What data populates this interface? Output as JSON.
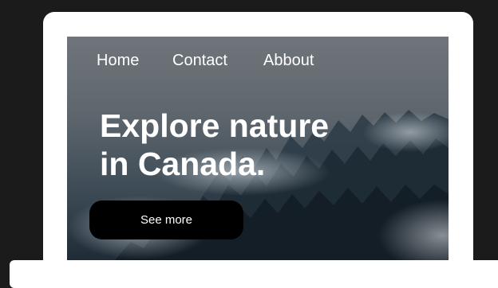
{
  "nav": {
    "items": [
      {
        "label": "Home"
      },
      {
        "label": "Contact"
      },
      {
        "label": "Abbout"
      }
    ]
  },
  "hero": {
    "title_line1": "Explore nature",
    "title_line2": "in Canada.",
    "cta_label": "See more"
  },
  "colors": {
    "page_background": "#1b1b1b",
    "device_frame": "#ffffff",
    "button_background": "#000000",
    "text": "#ffffff"
  }
}
